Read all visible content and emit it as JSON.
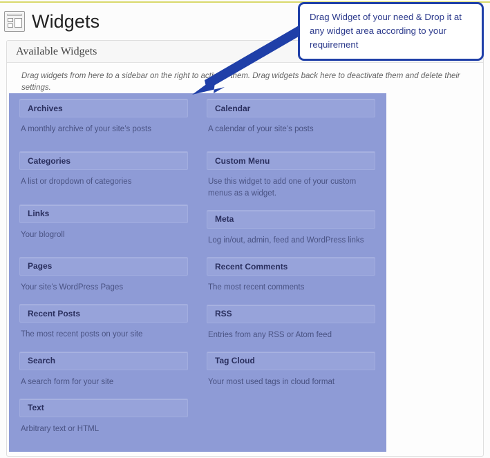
{
  "page": {
    "title": "Widgets",
    "icon": "widgets-layout-icon"
  },
  "panel": {
    "heading": "Available Widgets",
    "description": "Drag widgets from here to a sidebar on the right to activate them. Drag widgets back here to deactivate them and delete their settings."
  },
  "widgets": {
    "left_column": [
      {
        "title": "Archives",
        "description": "A monthly archive of your site’s posts",
        "spacing": "gap-xl"
      },
      {
        "title": "Categories",
        "description": "A list or dropdown of categories",
        "spacing": "gap-xl"
      },
      {
        "title": "Links",
        "description": "Your blogroll",
        "spacing": "gap-xl"
      },
      {
        "title": "Pages",
        "description": "Your site’s WordPress Pages",
        "spacing": "gap-l"
      },
      {
        "title": "Recent Posts",
        "description": "The most recent posts on your site",
        "spacing": "gap-l"
      },
      {
        "title": "Search",
        "description": "A search form for your site",
        "spacing": "gap-l"
      },
      {
        "title": "Text",
        "description": "Arbitrary text or HTML",
        "spacing": "gap-m"
      }
    ],
    "right_column": [
      {
        "title": "Calendar",
        "description": "A calendar of your site’s posts",
        "spacing": "gap-xl"
      },
      {
        "title": "Custom Menu",
        "description": "Use this widget to add one of your custom menus as a widget.",
        "spacing": "gap-l"
      },
      {
        "title": "Meta",
        "description": "Log in/out, admin, feed and WordPress links",
        "spacing": "gap-l"
      },
      {
        "title": "Recent Comments",
        "description": "The most recent comments",
        "spacing": "gap-l"
      },
      {
        "title": "RSS",
        "description": "Entries from any RSS or Atom feed",
        "spacing": "gap-l"
      },
      {
        "title": "Tag Cloud",
        "description": "Your most used tags in cloud format",
        "spacing": "gap-m"
      }
    ]
  },
  "annotation": {
    "text": "Drag Widget of your need & Drop it at any widget area according to your requirement",
    "arrow": "down-left-arrow",
    "color": "#1f3fa8"
  },
  "colors": {
    "drag_overlay": "#8e9bd6",
    "widget_title_bar": "#97a3da",
    "annotation_blue": "#1f3fa8",
    "top_rule_yellow": "#d9d96c"
  }
}
